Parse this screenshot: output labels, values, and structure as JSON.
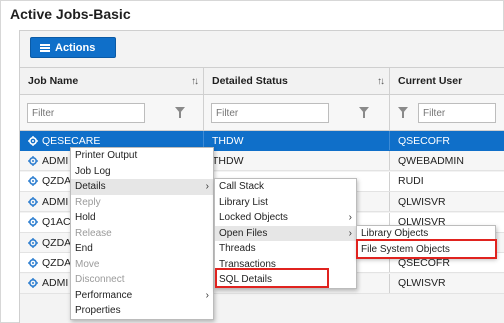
{
  "window": {
    "title": "Active Jobs-Basic"
  },
  "toolbar": {
    "actions_label": "Actions"
  },
  "columns": [
    {
      "label": "Job Name",
      "sortable": true
    },
    {
      "label": "Detailed Status",
      "sortable": true
    },
    {
      "label": "Current User",
      "sortable": false
    }
  ],
  "filters": {
    "placeholder": "Filter"
  },
  "rows": [
    {
      "job": "QESECARE",
      "status": "THDW",
      "user": "QSECOFR",
      "selected": true
    },
    {
      "job": "ADMI",
      "status": "THDW",
      "user": "QWEBADMIN"
    },
    {
      "job": "QZDA",
      "status": "",
      "user": "RUDI"
    },
    {
      "job": "ADMI",
      "status": "",
      "user": "QLWISVR"
    },
    {
      "job": "Q1AC",
      "status": "",
      "user": "QLWISVR"
    },
    {
      "job": "QZDA",
      "status": "",
      "user": "RUDI"
    },
    {
      "job": "QZDA",
      "status": "",
      "user": "QSECOFR"
    },
    {
      "job": "ADMI",
      "status": "THDW",
      "user": "QLWISVR"
    }
  ],
  "context_menu": {
    "items": [
      {
        "label": "Printer Output",
        "enabled": true
      },
      {
        "label": "Job Log",
        "enabled": true
      },
      {
        "label": "Details",
        "enabled": true,
        "submenu": true,
        "highlighted": true
      },
      {
        "label": "Reply",
        "enabled": false
      },
      {
        "label": "Hold",
        "enabled": true
      },
      {
        "label": "Release",
        "enabled": false
      },
      {
        "label": "End",
        "enabled": true
      },
      {
        "label": "Move",
        "enabled": false
      },
      {
        "label": "Disconnect",
        "enabled": false
      },
      {
        "label": "Performance",
        "enabled": true,
        "submenu": true
      },
      {
        "label": "Properties",
        "enabled": true
      }
    ]
  },
  "details_menu": {
    "items": [
      {
        "label": "Call Stack"
      },
      {
        "label": "Library List"
      },
      {
        "label": "Locked Objects",
        "submenu": true
      },
      {
        "label": "Open Files",
        "submenu": true,
        "highlighted": true
      },
      {
        "label": "Threads"
      },
      {
        "label": "Transactions"
      },
      {
        "label": "SQL Details",
        "boxed": true
      }
    ]
  },
  "open_files_menu": {
    "items": [
      {
        "label": "Library Objects"
      },
      {
        "label": "File System Objects",
        "boxed": true
      }
    ]
  },
  "colors": {
    "accent": "#0f6fc9",
    "annotation": "#e0231f"
  }
}
